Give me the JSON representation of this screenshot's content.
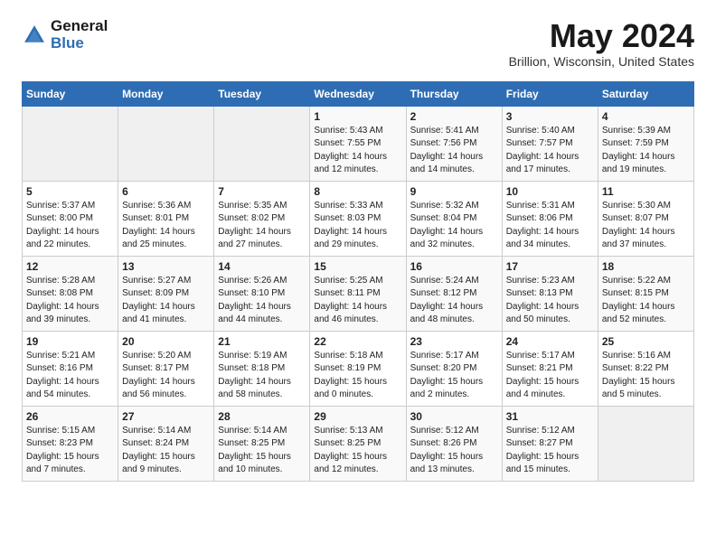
{
  "header": {
    "logo_general": "General",
    "logo_blue": "Blue",
    "month_title": "May 2024",
    "location": "Brillion, Wisconsin, United States"
  },
  "weekdays": [
    "Sunday",
    "Monday",
    "Tuesday",
    "Wednesday",
    "Thursday",
    "Friday",
    "Saturday"
  ],
  "weeks": [
    [
      {
        "day": "",
        "empty": true
      },
      {
        "day": "",
        "empty": true
      },
      {
        "day": "",
        "empty": true
      },
      {
        "day": "1",
        "sunrise": "5:43 AM",
        "sunset": "7:55 PM",
        "daylight": "14 hours and 12 minutes."
      },
      {
        "day": "2",
        "sunrise": "5:41 AM",
        "sunset": "7:56 PM",
        "daylight": "14 hours and 14 minutes."
      },
      {
        "day": "3",
        "sunrise": "5:40 AM",
        "sunset": "7:57 PM",
        "daylight": "14 hours and 17 minutes."
      },
      {
        "day": "4",
        "sunrise": "5:39 AM",
        "sunset": "7:59 PM",
        "daylight": "14 hours and 19 minutes."
      }
    ],
    [
      {
        "day": "5",
        "sunrise": "5:37 AM",
        "sunset": "8:00 PM",
        "daylight": "14 hours and 22 minutes."
      },
      {
        "day": "6",
        "sunrise": "5:36 AM",
        "sunset": "8:01 PM",
        "daylight": "14 hours and 25 minutes."
      },
      {
        "day": "7",
        "sunrise": "5:35 AM",
        "sunset": "8:02 PM",
        "daylight": "14 hours and 27 minutes."
      },
      {
        "day": "8",
        "sunrise": "5:33 AM",
        "sunset": "8:03 PM",
        "daylight": "14 hours and 29 minutes."
      },
      {
        "day": "9",
        "sunrise": "5:32 AM",
        "sunset": "8:04 PM",
        "daylight": "14 hours and 32 minutes."
      },
      {
        "day": "10",
        "sunrise": "5:31 AM",
        "sunset": "8:06 PM",
        "daylight": "14 hours and 34 minutes."
      },
      {
        "day": "11",
        "sunrise": "5:30 AM",
        "sunset": "8:07 PM",
        "daylight": "14 hours and 37 minutes."
      }
    ],
    [
      {
        "day": "12",
        "sunrise": "5:28 AM",
        "sunset": "8:08 PM",
        "daylight": "14 hours and 39 minutes."
      },
      {
        "day": "13",
        "sunrise": "5:27 AM",
        "sunset": "8:09 PM",
        "daylight": "14 hours and 41 minutes."
      },
      {
        "day": "14",
        "sunrise": "5:26 AM",
        "sunset": "8:10 PM",
        "daylight": "14 hours and 44 minutes."
      },
      {
        "day": "15",
        "sunrise": "5:25 AM",
        "sunset": "8:11 PM",
        "daylight": "14 hours and 46 minutes."
      },
      {
        "day": "16",
        "sunrise": "5:24 AM",
        "sunset": "8:12 PM",
        "daylight": "14 hours and 48 minutes."
      },
      {
        "day": "17",
        "sunrise": "5:23 AM",
        "sunset": "8:13 PM",
        "daylight": "14 hours and 50 minutes."
      },
      {
        "day": "18",
        "sunrise": "5:22 AM",
        "sunset": "8:15 PM",
        "daylight": "14 hours and 52 minutes."
      }
    ],
    [
      {
        "day": "19",
        "sunrise": "5:21 AM",
        "sunset": "8:16 PM",
        "daylight": "14 hours and 54 minutes."
      },
      {
        "day": "20",
        "sunrise": "5:20 AM",
        "sunset": "8:17 PM",
        "daylight": "14 hours and 56 minutes."
      },
      {
        "day": "21",
        "sunrise": "5:19 AM",
        "sunset": "8:18 PM",
        "daylight": "14 hours and 58 minutes."
      },
      {
        "day": "22",
        "sunrise": "5:18 AM",
        "sunset": "8:19 PM",
        "daylight": "15 hours and 0 minutes."
      },
      {
        "day": "23",
        "sunrise": "5:17 AM",
        "sunset": "8:20 PM",
        "daylight": "15 hours and 2 minutes."
      },
      {
        "day": "24",
        "sunrise": "5:17 AM",
        "sunset": "8:21 PM",
        "daylight": "15 hours and 4 minutes."
      },
      {
        "day": "25",
        "sunrise": "5:16 AM",
        "sunset": "8:22 PM",
        "daylight": "15 hours and 5 minutes."
      }
    ],
    [
      {
        "day": "26",
        "sunrise": "5:15 AM",
        "sunset": "8:23 PM",
        "daylight": "15 hours and 7 minutes."
      },
      {
        "day": "27",
        "sunrise": "5:14 AM",
        "sunset": "8:24 PM",
        "daylight": "15 hours and 9 minutes."
      },
      {
        "day": "28",
        "sunrise": "5:14 AM",
        "sunset": "8:25 PM",
        "daylight": "15 hours and 10 minutes."
      },
      {
        "day": "29",
        "sunrise": "5:13 AM",
        "sunset": "8:25 PM",
        "daylight": "15 hours and 12 minutes."
      },
      {
        "day": "30",
        "sunrise": "5:12 AM",
        "sunset": "8:26 PM",
        "daylight": "15 hours and 13 minutes."
      },
      {
        "day": "31",
        "sunrise": "5:12 AM",
        "sunset": "8:27 PM",
        "daylight": "15 hours and 15 minutes."
      },
      {
        "day": "",
        "empty": true
      }
    ]
  ],
  "labels": {
    "sunrise": "Sunrise:",
    "sunset": "Sunset:",
    "daylight": "Daylight:"
  }
}
